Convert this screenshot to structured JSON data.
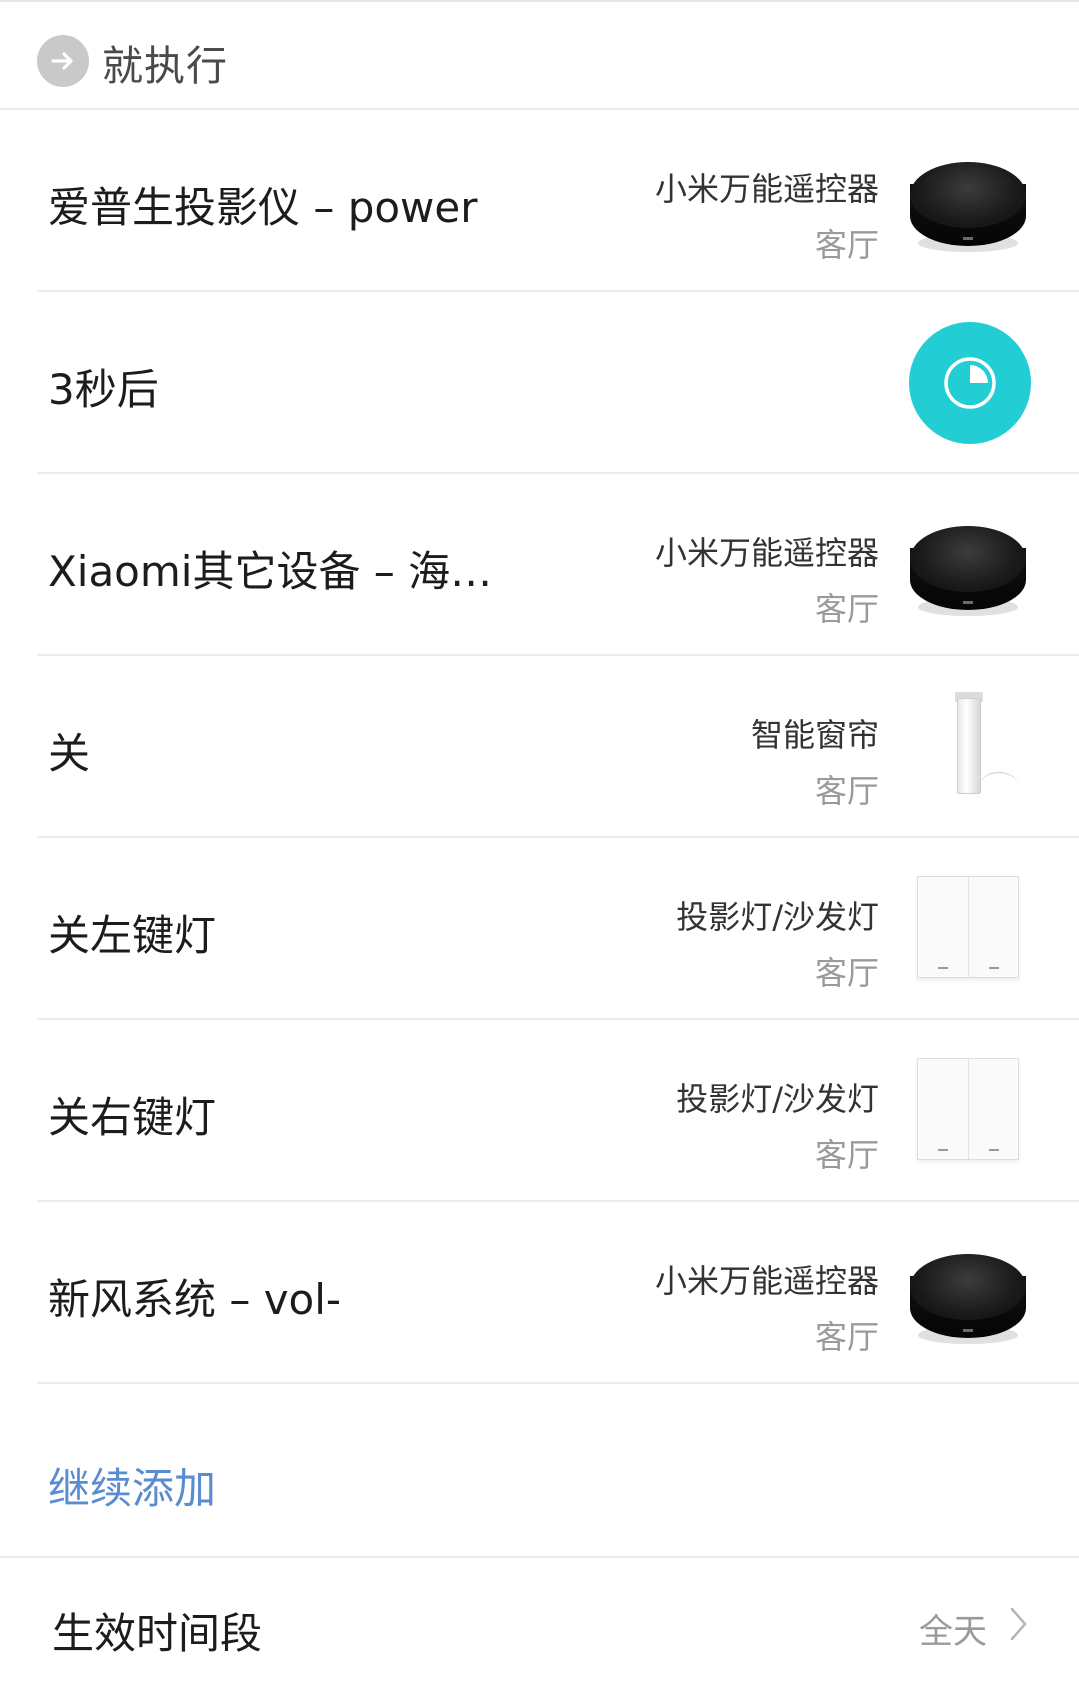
{
  "header": {
    "title": "就执行",
    "icon": "arrow-right-circle-icon"
  },
  "actions": [
    {
      "title": "爱普生投影仪 – power",
      "device": "小米万能遥控器",
      "room": "客厅",
      "icon": "ir-remote-puck"
    },
    {
      "title": "3秒后",
      "device": "",
      "room": "",
      "icon": "timer-icon",
      "accent": "#22cdd3"
    },
    {
      "title": "Xiaomi其它设备 – 海…",
      "device": "小米万能遥控器",
      "room": "客厅",
      "icon": "ir-remote-puck"
    },
    {
      "title": "关",
      "device": "智能窗帘",
      "room": "客厅",
      "icon": "curtain-motor"
    },
    {
      "title": "关左键灯",
      "device": "投影灯/沙发灯",
      "room": "客厅",
      "icon": "wall-switch"
    },
    {
      "title": "关右键灯",
      "device": "投影灯/沙发灯",
      "room": "客厅",
      "icon": "wall-switch"
    },
    {
      "title": "新风系统 – vol-",
      "device": "小米万能遥控器",
      "room": "客厅",
      "icon": "ir-remote-puck"
    }
  ],
  "add_more": {
    "label": "继续添加",
    "color": "#5b8bd0"
  },
  "effective_period": {
    "label": "生效时间段",
    "value": "全天"
  }
}
